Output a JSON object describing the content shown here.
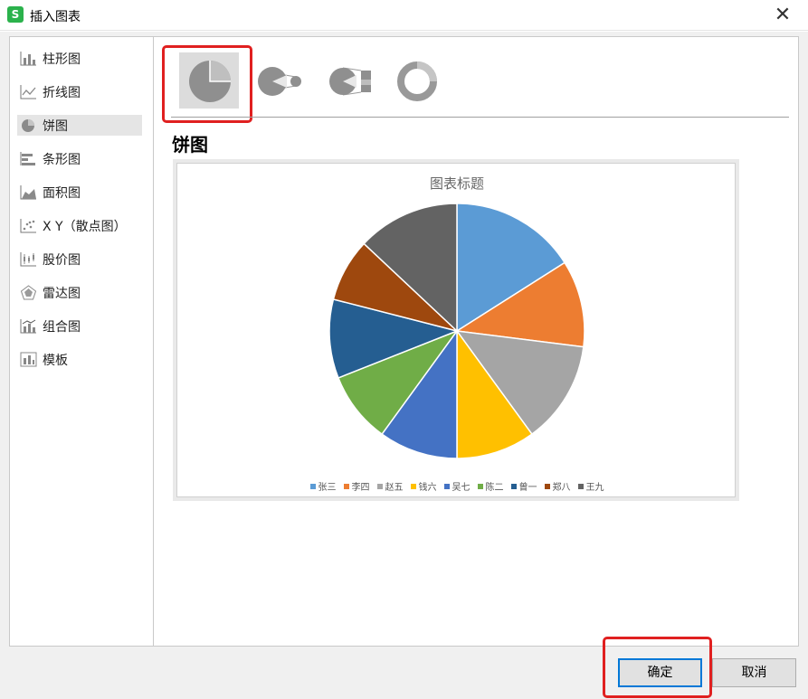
{
  "window": {
    "title": "插入图表",
    "app_icon": "S",
    "close_glyph": "✕"
  },
  "sidebar": {
    "items": [
      {
        "label": "柱形图",
        "icon": "column-chart-icon"
      },
      {
        "label": "折线图",
        "icon": "line-chart-icon"
      },
      {
        "label": "饼图",
        "icon": "pie-chart-icon",
        "selected": true
      },
      {
        "label": "条形图",
        "icon": "bar-chart-icon"
      },
      {
        "label": "面积图",
        "icon": "area-chart-icon"
      },
      {
        "label": "X Y（散点图）",
        "icon": "scatter-chart-icon"
      },
      {
        "label": "股价图",
        "icon": "stock-chart-icon"
      },
      {
        "label": "雷达图",
        "icon": "radar-chart-icon"
      },
      {
        "label": "组合图",
        "icon": "combo-chart-icon"
      },
      {
        "label": "模板",
        "icon": "template-icon"
      }
    ]
  },
  "subtypes": [
    {
      "icon": "pie-subtype-icon",
      "selected": true
    },
    {
      "icon": "pie-of-pie-icon"
    },
    {
      "icon": "bar-of-pie-icon"
    },
    {
      "icon": "doughnut-icon"
    }
  ],
  "selected_chart_name": "饼图",
  "chart_data": {
    "type": "pie",
    "title": "图表标题",
    "categories": [
      "张三",
      "李四",
      "赵五",
      "钱六",
      "吴七",
      "陈二",
      "曾一",
      "郑八",
      "王九"
    ],
    "values": [
      16,
      11,
      13,
      10,
      10,
      9,
      10,
      8,
      13
    ],
    "colors": [
      "#5b9bd5",
      "#ed7d31",
      "#a5a5a5",
      "#ffc000",
      "#4472c4",
      "#70ad47",
      "#255e91",
      "#9e480e",
      "#636363"
    ],
    "legend": "bottom"
  },
  "buttons": {
    "ok": "确定",
    "cancel": "取消"
  },
  "colors": {
    "highlight": "#e02020",
    "accent": "#0078d7"
  }
}
